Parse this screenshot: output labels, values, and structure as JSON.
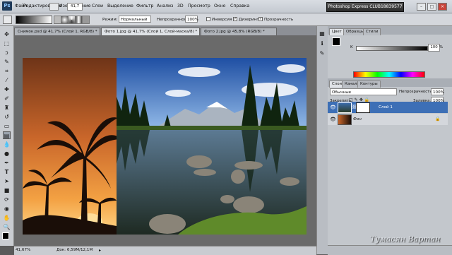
{
  "app": {
    "logo": "Ps",
    "title_box": "Photoshop Express CLUB18839577"
  },
  "menu": [
    "Файл",
    "Редактирование",
    "Изображение",
    "Слои",
    "Выделение",
    "Фильтр",
    "Анализ",
    "3D",
    "Просмотр",
    "Окно",
    "Справка"
  ],
  "menu_zoom": "41,7",
  "options": {
    "mode_label": "Режим:",
    "mode_value": "Нормальный",
    "opacity_label": "Непрозрачность:",
    "opacity_value": "100%",
    "inverse_label": "Инверсия",
    "dither_label": "Дизеринг",
    "transparency_label": "Прозрачность"
  },
  "tabs": [
    {
      "label": "Снимок.psd @ 41,7% (Слой 1, RGB/8) *",
      "active": false
    },
    {
      "label": "Фото 1.jpg @ 41,7% (Слой 1, Слой-маска/8) *",
      "active": true
    },
    {
      "label": "Фото 2.jpg @ 45,8% (RGB/8) *",
      "active": false
    }
  ],
  "status": {
    "zoom": "41,67%",
    "doc": "Док: 6,59M/12,1M"
  },
  "color_panel": {
    "tabs": [
      "Цвет",
      "Образцы",
      "Стили"
    ],
    "slider_letter": "K",
    "value": "100",
    "unit": "%"
  },
  "layers_panel": {
    "tabs": [
      "Слои",
      "Каналы",
      "Контуры"
    ],
    "blend_mode": "Обычные",
    "opacity_label": "Непрозрачность:",
    "opacity_value": "100%",
    "lock_label": "Закрепить:",
    "fill_label": "Заливка:",
    "fill_value": "100%",
    "layers": [
      {
        "name": "Слой 1",
        "selected": true
      },
      {
        "name": "Фон",
        "selected": false
      }
    ]
  },
  "watermark": "Тумасян Вартан",
  "colors": {
    "accent_selected": "#3d6fb6",
    "menubar": "#d4d7dc"
  },
  "icons": [
    "move-icon",
    "marquee-icon",
    "lasso-icon",
    "quick-select-icon",
    "crop-icon",
    "eyedropper-icon",
    "healing-icon",
    "brush-icon",
    "stamp-icon",
    "history-brush-icon",
    "eraser-icon",
    "gradient-icon",
    "blur-icon",
    "dodge-icon",
    "pen-icon",
    "type-icon",
    "path-select-icon",
    "shape-icon",
    "3d-rotate-icon",
    "3d-camera-icon",
    "hand-icon",
    "zoom-icon"
  ]
}
